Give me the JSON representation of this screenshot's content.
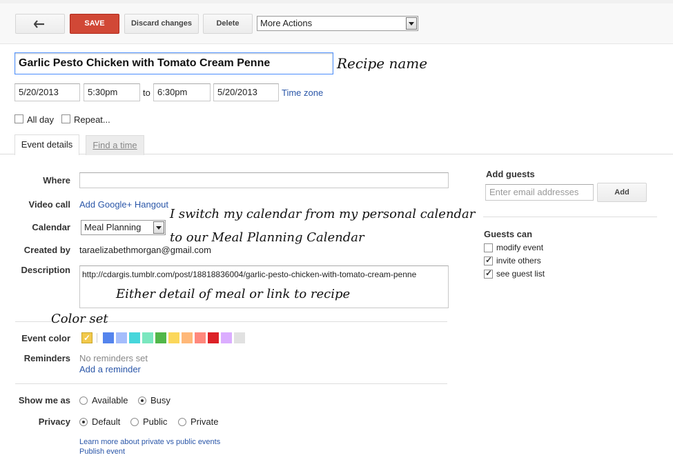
{
  "toolbar": {
    "back_icon": "back-arrow-icon",
    "save_label": "SAVE",
    "discard_label": "Discard changes",
    "delete_label": "Delete",
    "more_actions_label": "More Actions"
  },
  "event": {
    "title": "Garlic Pesto Chicken with Tomato Cream Penne",
    "start_date": "5/20/2013",
    "start_time": "5:30pm",
    "to_label": "to",
    "end_time": "6:30pm",
    "end_date": "5/20/2013",
    "time_zone_label": "Time zone",
    "all_day_label": "All day",
    "repeat_label": "Repeat..."
  },
  "tabs": {
    "event_details": "Event details",
    "find_time": "Find a time"
  },
  "details": {
    "where_label": "Where",
    "video_call_label": "Video call",
    "hangout_link": "Add Google+ Hangout",
    "calendar_label": "Calendar",
    "calendar_value": "Meal Planning",
    "created_by_label": "Created by",
    "created_by_value": "taraelizabethmorgan@gmail.com",
    "description_label": "Description",
    "description_value": "http://cdargis.tumblr.com/post/18818836004/garlic-pesto-chicken-with-tomato-cream-penne",
    "event_color_label": "Event color",
    "event_colors": [
      "#f2c94c",
      "#5484ed",
      "#a4bdfc",
      "#46d6db",
      "#7ae7bf",
      "#51b749",
      "#fbd75b",
      "#ffb878",
      "#ff887c",
      "#dc2127",
      "#dbadff",
      "#e1e1e1"
    ],
    "reminders_label": "Reminders",
    "no_reminders": "No reminders set",
    "add_reminder": "Add a reminder",
    "show_me_as_label": "Show me as",
    "available_label": "Available",
    "busy_label": "Busy",
    "privacy_label": "Privacy",
    "default_label": "Default",
    "public_label": "Public",
    "private_label": "Private",
    "learn_more_link": "Learn more about private vs public events",
    "publish_link": "Publish event"
  },
  "guests": {
    "add_guests_label": "Add guests",
    "email_placeholder": "Enter email addresses",
    "add_button": "Add",
    "guests_can_label": "Guests can",
    "modify_event": "modify event",
    "invite_others": "invite others",
    "see_guest_list": "see guest list"
  },
  "annotations": {
    "recipe_name": "Recipe name",
    "calendar_note_1": "I switch my calendar from my personal calendar",
    "calendar_note_2": "to our Meal Planning Calendar",
    "description_note": "Either detail of meal or link to recipe",
    "color_note": "Color set"
  }
}
